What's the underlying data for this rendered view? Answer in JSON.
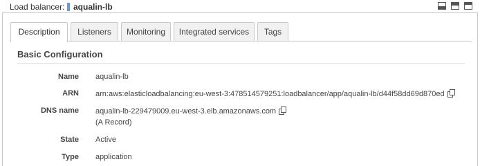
{
  "header": {
    "label": "Load balancer:",
    "name": "aqualin-lb",
    "accent_color": "#6f9bc6"
  },
  "window_controls": [
    "minimize-icon",
    "restore-icon",
    "maximize-icon"
  ],
  "tabs": [
    {
      "label": "Description",
      "active": true
    },
    {
      "label": "Listeners",
      "active": false
    },
    {
      "label": "Monitoring",
      "active": false
    },
    {
      "label": "Integrated services",
      "active": false
    },
    {
      "label": "Tags",
      "active": false
    }
  ],
  "section": {
    "title": "Basic Configuration",
    "rows": [
      {
        "label": "Name",
        "value": "aqualin-lb"
      },
      {
        "label": "ARN",
        "value": "arn:aws:elasticloadbalancing:eu-west-3:478514579251:loadbalancer/app/aqualin-lb/d44f58dd69d870ed",
        "icon": "copy-icon"
      },
      {
        "label": "DNS name",
        "value": "aqualin-lb-229479009.eu-west-3.elb.amazonaws.com",
        "note": "(A Record)",
        "icon": "copy-icon"
      },
      {
        "label": "State",
        "value": "Active"
      },
      {
        "label": "Type",
        "value": "application"
      }
    ]
  }
}
